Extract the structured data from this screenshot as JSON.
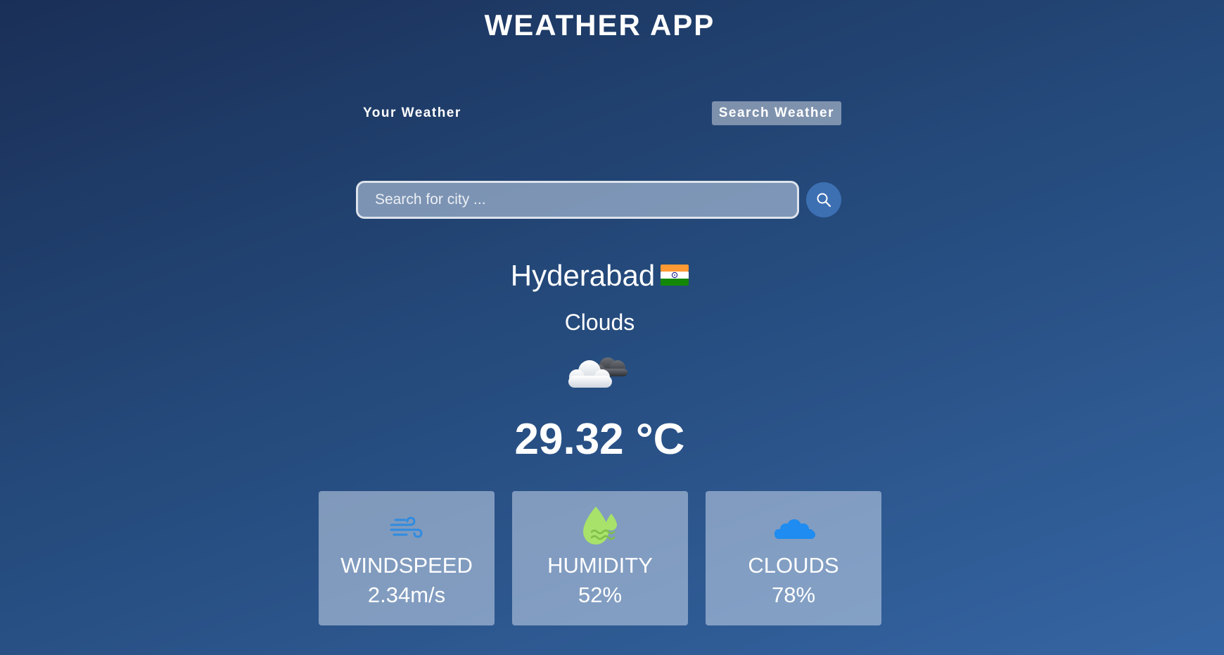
{
  "header": {
    "title": "WEATHER APP"
  },
  "tabs": [
    {
      "label": "Your Weather",
      "active": false
    },
    {
      "label": "Search Weather",
      "active": true
    }
  ],
  "search": {
    "placeholder": "Search for city ...",
    "value": "",
    "button_icon": "search-icon"
  },
  "location": {
    "city": "Hyderabad",
    "country_flag_icon": "india-flag-icon"
  },
  "weather": {
    "condition": "Clouds",
    "icon": "cloudy-icon",
    "temperature": "29.32 °C"
  },
  "stats": [
    {
      "label": "WINDSPEED",
      "value": "2.34m/s",
      "icon": "wind-icon"
    },
    {
      "label": "HUMIDITY",
      "value": "52%",
      "icon": "humidity-icon"
    },
    {
      "label": "CLOUDS",
      "value": "78%",
      "icon": "clouds-icon"
    }
  ],
  "colors": {
    "background_top": "#1a2f57",
    "background_bottom": "#3565a3",
    "search_button": "#3d6fb3",
    "wind_icon": "#2f8be0",
    "humidity_icon": "#a8e26a",
    "clouds_icon": "#1e8cf0"
  }
}
